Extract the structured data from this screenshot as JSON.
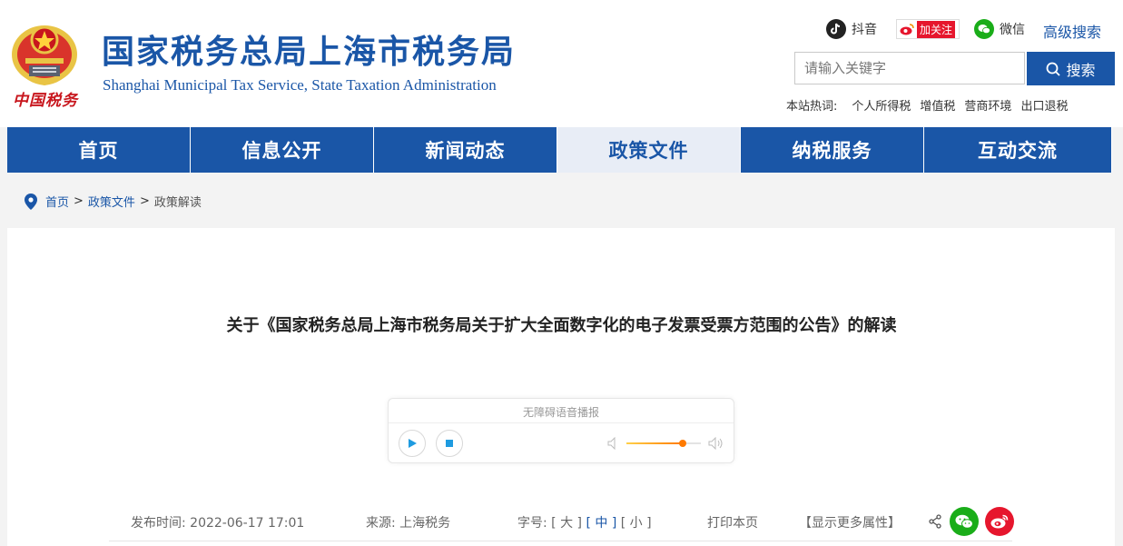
{
  "header": {
    "logo_text": "中国税务",
    "title": "国家税务总局上海市税务局",
    "subtitle": "Shanghai Municipal Tax Service, State Taxation Administration",
    "social": [
      {
        "label": "抖音",
        "icon": "tiktok-icon"
      },
      {
        "label": "加关注",
        "icon": "weibo-icon"
      },
      {
        "label": "微信",
        "icon": "wechat-icon"
      }
    ],
    "advanced_search": "高级搜索",
    "search": {
      "placeholder": "请输入关键字",
      "button": "搜索"
    },
    "hot": {
      "label": "本站热词:",
      "keywords": [
        "个人所得税",
        "增值税",
        "营商环境",
        "出口退税"
      ]
    }
  },
  "nav": {
    "items": [
      "首页",
      "信息公开",
      "新闻动态",
      "政策文件",
      "纳税服务",
      "互动交流"
    ],
    "active": "政策文件"
  },
  "breadcrumb": {
    "items": [
      "首页",
      "政策文件",
      "政策解读"
    ],
    "separator": ">"
  },
  "article": {
    "title": "关于《国家税务总局上海市税务局关于扩大全面数字化的电子发票受票方范围的公告》的解读",
    "player": {
      "label": "无障碍语音播报",
      "volume": 0.75
    },
    "meta": {
      "publish_label": "发布时间:",
      "publish_time": "2022-06-17 17:01",
      "source_label": "来源:",
      "source": "上海税务",
      "font_label": "字号:",
      "font_large": "[ 大 ]",
      "font_medium": "[ 中 ]",
      "font_small": "[ 小 ]",
      "print": "打印本页",
      "more": "【显示更多属性】"
    }
  },
  "colors": {
    "brand": "#1a56a7",
    "accent_red": "#c8161d",
    "wechat": "#1aad19",
    "weibo": "#e6162d"
  }
}
